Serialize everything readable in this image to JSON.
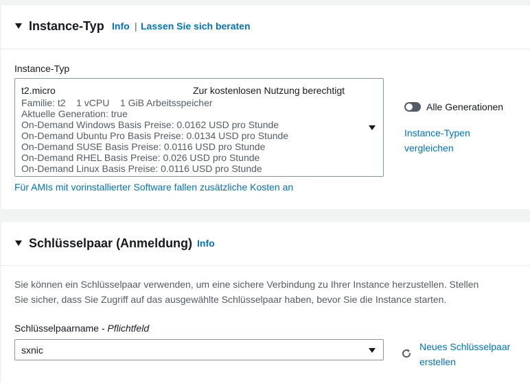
{
  "instance_section": {
    "title": "Instance-Typ",
    "info_link": "Info",
    "separator": "|",
    "advice_link": "Lassen Sie sich beraten",
    "field_label": "Instance-Typ",
    "selected": {
      "name": "t2.micro",
      "tag": "Zur kostenlosen Nutzung berechtigt",
      "details": [
        "Familie: t2    1 vCPU    1 GiB Arbeitsspeicher",
        "Aktuelle Generation: true",
        "On-Demand Windows Basis Preise: 0.0162 USD pro Stunde",
        "On-Demand Ubuntu Pro Basis Preise: 0.0134 USD pro Stunde",
        "On-Demand SUSE Basis Preise: 0.0116 USD pro Stunde",
        "On-Demand RHEL Basis Preise: 0.026 USD pro Stunde",
        "On-Demand Linux Basis Preise: 0.0116 USD pro Stunde"
      ]
    },
    "all_generations_label": "Alle Generationen",
    "all_generations_on": false,
    "compare_link_line1": "Instance-Typen",
    "compare_link_line2": "vergleichen",
    "ami_note": "Für AMIs mit vorinstallierter Software fallen zusätzliche Kosten an"
  },
  "keypair_section": {
    "title": "Schlüsselpaar (Anmeldung)",
    "info_link": "Info",
    "description_line1": "Sie können ein Schlüsselpaar verwenden, um eine sichere Verbindung zu Ihrer Instance herzustellen. Stellen",
    "description_line2": "Sie sicher, dass Sie Zugriff auf das ausgewählte Schlüsselpaar haben, bevor Sie die Instance starten.",
    "field_label": "Schlüsselpaarname",
    "field_label_sep": " - ",
    "required_hint": "Pflichtfeld",
    "selected_value": "sxnic",
    "new_link_line1": "Neues Schlüsselpaar",
    "new_link_line2": "erstellen"
  },
  "icons": {
    "collapse": "caret-down-icon",
    "dropdown": "dropdown-arrow-icon",
    "refresh": "refresh-icon"
  }
}
